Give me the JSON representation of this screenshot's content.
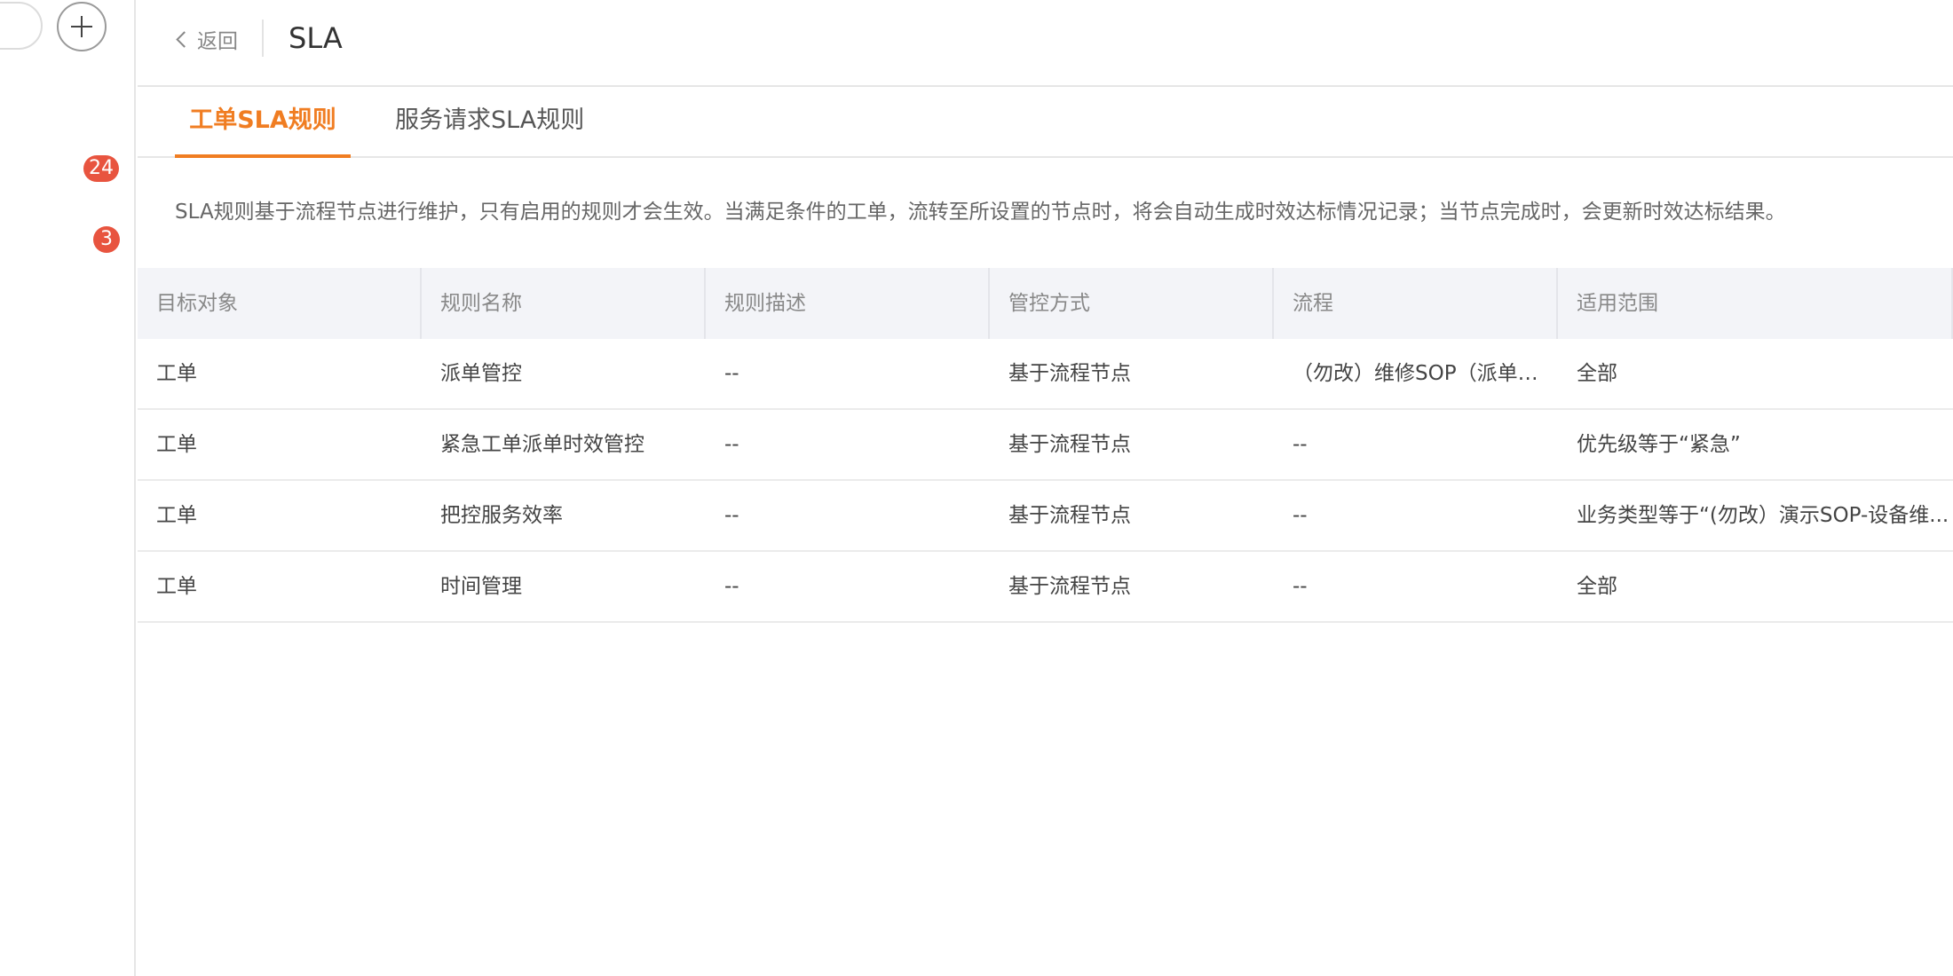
{
  "sidebar": {
    "badges": [
      "24",
      "3"
    ]
  },
  "header": {
    "back_label": "返回",
    "title": "SLA"
  },
  "tabs": [
    {
      "label": "工单SLA规则",
      "active": true
    },
    {
      "label": "服务请求SLA规则",
      "active": false
    }
  ],
  "notice": "SLA规则基于流程节点进行维护，只有启用的规则才会生效。当满足条件的工单，流转至所设置的节点时，将会自动生成时效达标情况记录；当节点完成时，会更新时效达标结果。",
  "table": {
    "columns": [
      "目标对象",
      "规则名称",
      "规则描述",
      "管控方式",
      "流程",
      "适用范围"
    ],
    "rows": [
      [
        "工单",
        "派单管控",
        "--",
        "基于流程节点",
        "（勿改）维修SOP（派单+维修+验收）",
        "全部"
      ],
      [
        "工单",
        "紧急工单派单时效管控",
        "--",
        "基于流程节点",
        "--",
        "优先级等于“紧急”"
      ],
      [
        "工单",
        "把控服务效率",
        "--",
        "基于流程节点",
        "--",
        "业务类型等于“(勿改）演示SOP-设备维..."
      ],
      [
        "工单",
        "时间管理",
        "--",
        "基于流程节点",
        "--",
        "全部"
      ]
    ]
  },
  "colors": {
    "accent": "#f07d22",
    "badge": "#e8543f"
  }
}
